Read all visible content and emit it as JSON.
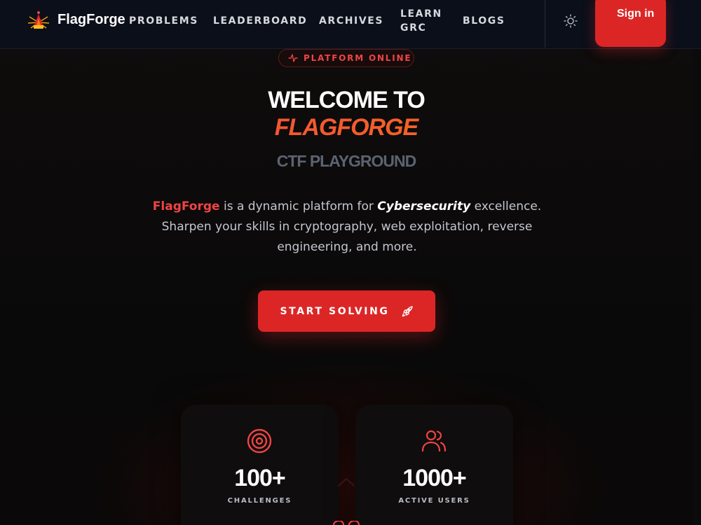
{
  "nav": {
    "brand": "FlagForge",
    "items": [
      {
        "label": "PROBLEMS"
      },
      {
        "label": "LEADERBOARD"
      },
      {
        "label": "ARCHIVES"
      },
      {
        "label": "LEARN GRC"
      },
      {
        "label": "BLOGS"
      }
    ],
    "signin": "Sign in",
    "theme_icon": "sun-icon",
    "logo_icon": "flag-forge-logo"
  },
  "hero": {
    "badge": "PLATFORM ONLINE",
    "badge_icon": "activity-icon",
    "title_line1": "WELCOME TO",
    "title_line2": "FLAGFORGE",
    "subtitle": "CTF PLAYGROUND",
    "description": {
      "brand": "FlagForge",
      "part1": " is a dynamic platform for ",
      "emphasis": "Cybersecurity",
      "part2": " excellence. Sharpen your skills in cryptography, web exploitation, reverse engineering, and more."
    },
    "cta": "START SOLVING",
    "cta_icon": "rocket-icon"
  },
  "stats": [
    {
      "icon": "target-icon",
      "value": "100+",
      "label": "CHALLENGES"
    },
    {
      "icon": "users-icon",
      "value": "1000+",
      "label": "ACTIVE USERS"
    }
  ],
  "colors": {
    "accent": "#dc2626",
    "accent_text": "#ef4444",
    "gradient_orange": "#f97316",
    "background": "#0a0909",
    "nav_bg": "#0b0f1a"
  }
}
